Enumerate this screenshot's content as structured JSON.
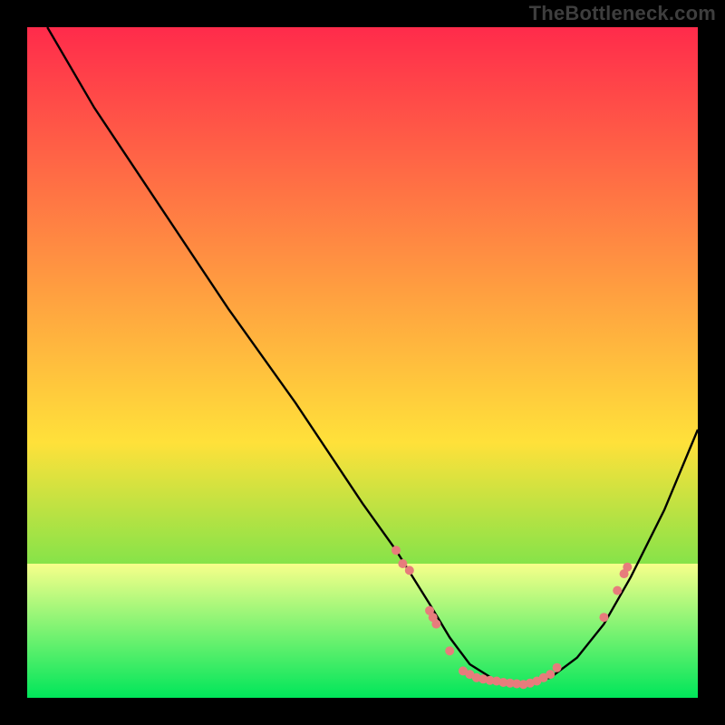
{
  "watermark": "TheBottleneck.com",
  "chart_data": {
    "type": "line",
    "title": "",
    "xlabel": "",
    "ylabel": "",
    "xlim": [
      0,
      100
    ],
    "ylim": [
      0,
      100
    ],
    "grid": false,
    "legend": false,
    "background_gradient": {
      "top": "#ff2b4b",
      "mid": "#ffe13a",
      "bottom": "#00e65a"
    },
    "highlight_band": {
      "y_from": 0,
      "y_to": 20,
      "color_top": "#f7ff8a",
      "color_bottom": "#00e65a"
    },
    "curve": {
      "x": [
        3,
        10,
        20,
        30,
        40,
        50,
        55,
        60,
        63,
        66,
        70,
        74,
        78,
        82,
        86,
        90,
        95,
        100
      ],
      "y": [
        100,
        88,
        73,
        58,
        44,
        29,
        22,
        14,
        9,
        5,
        2.5,
        2,
        3,
        6,
        11,
        18,
        28,
        40
      ]
    },
    "markers": {
      "color": "#e77c7c",
      "radius": 5,
      "points": [
        {
          "x": 55,
          "y": 22
        },
        {
          "x": 56,
          "y": 20
        },
        {
          "x": 57,
          "y": 19
        },
        {
          "x": 60,
          "y": 13
        },
        {
          "x": 60.5,
          "y": 12
        },
        {
          "x": 61,
          "y": 11
        },
        {
          "x": 63,
          "y": 7
        },
        {
          "x": 65,
          "y": 4
        },
        {
          "x": 66,
          "y": 3.5
        },
        {
          "x": 67,
          "y": 3
        },
        {
          "x": 68,
          "y": 2.8
        },
        {
          "x": 69,
          "y": 2.6
        },
        {
          "x": 70,
          "y": 2.5
        },
        {
          "x": 71,
          "y": 2.3
        },
        {
          "x": 72,
          "y": 2.2
        },
        {
          "x": 73,
          "y": 2.1
        },
        {
          "x": 74,
          "y": 2
        },
        {
          "x": 75,
          "y": 2.2
        },
        {
          "x": 76,
          "y": 2.5
        },
        {
          "x": 77,
          "y": 3
        },
        {
          "x": 78,
          "y": 3.5
        },
        {
          "x": 79,
          "y": 4.5
        },
        {
          "x": 86,
          "y": 12
        },
        {
          "x": 88,
          "y": 16
        },
        {
          "x": 89,
          "y": 18.5
        },
        {
          "x": 89.5,
          "y": 19.5
        }
      ]
    }
  }
}
